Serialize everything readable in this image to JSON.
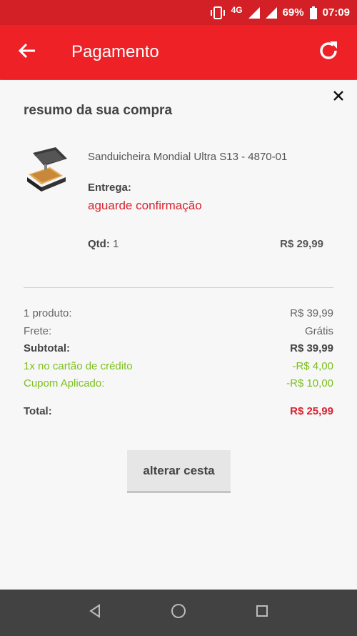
{
  "status_bar": {
    "network": "4G",
    "battery": "69%",
    "time": "07:09",
    "icons": [
      "vibrate-icon",
      "signal-icon",
      "signal-icon",
      "battery-icon"
    ]
  },
  "app_bar": {
    "title": "Pagamento",
    "back_icon": "arrow-left-icon",
    "refresh_icon": "refresh-icon"
  },
  "summary_sheet": {
    "heading": "resumo da sua compra",
    "close_icon": "close-icon",
    "product": {
      "name": "Sanduicheira Mondial Ultra S13 - 4870-01",
      "delivery_label": "Entrega:",
      "delivery_status": "aguarde confirmação",
      "qty_label": "Qtd:",
      "qty_value": "1",
      "price": "R$ 29,99"
    },
    "totals": [
      {
        "label": "1 produto:",
        "value": "R$ 39,99",
        "style": "normal"
      },
      {
        "label": "Frete:",
        "value": "Grátis",
        "style": "normal"
      },
      {
        "label": "Subtotal:",
        "value": "R$ 39,99",
        "style": "bold"
      },
      {
        "label": "1x no cartão de crédito",
        "value": "-R$ 4,00",
        "style": "green"
      },
      {
        "label": "Cupom Aplicado:",
        "value": "-R$ 10,00",
        "style": "green"
      }
    ],
    "total": {
      "label": "Total:",
      "value": "R$ 25,99"
    },
    "change_button": "alterar cesta"
  },
  "colors": {
    "status_bar": "#d32026",
    "app_bar": "#ee2127",
    "accent_red": "#d9232e",
    "discount_green": "#7cbf1e",
    "nav_bar": "#424242"
  },
  "nav_bar": {
    "icons": [
      "back-triangle-icon",
      "home-circle-icon",
      "recents-square-icon"
    ]
  }
}
